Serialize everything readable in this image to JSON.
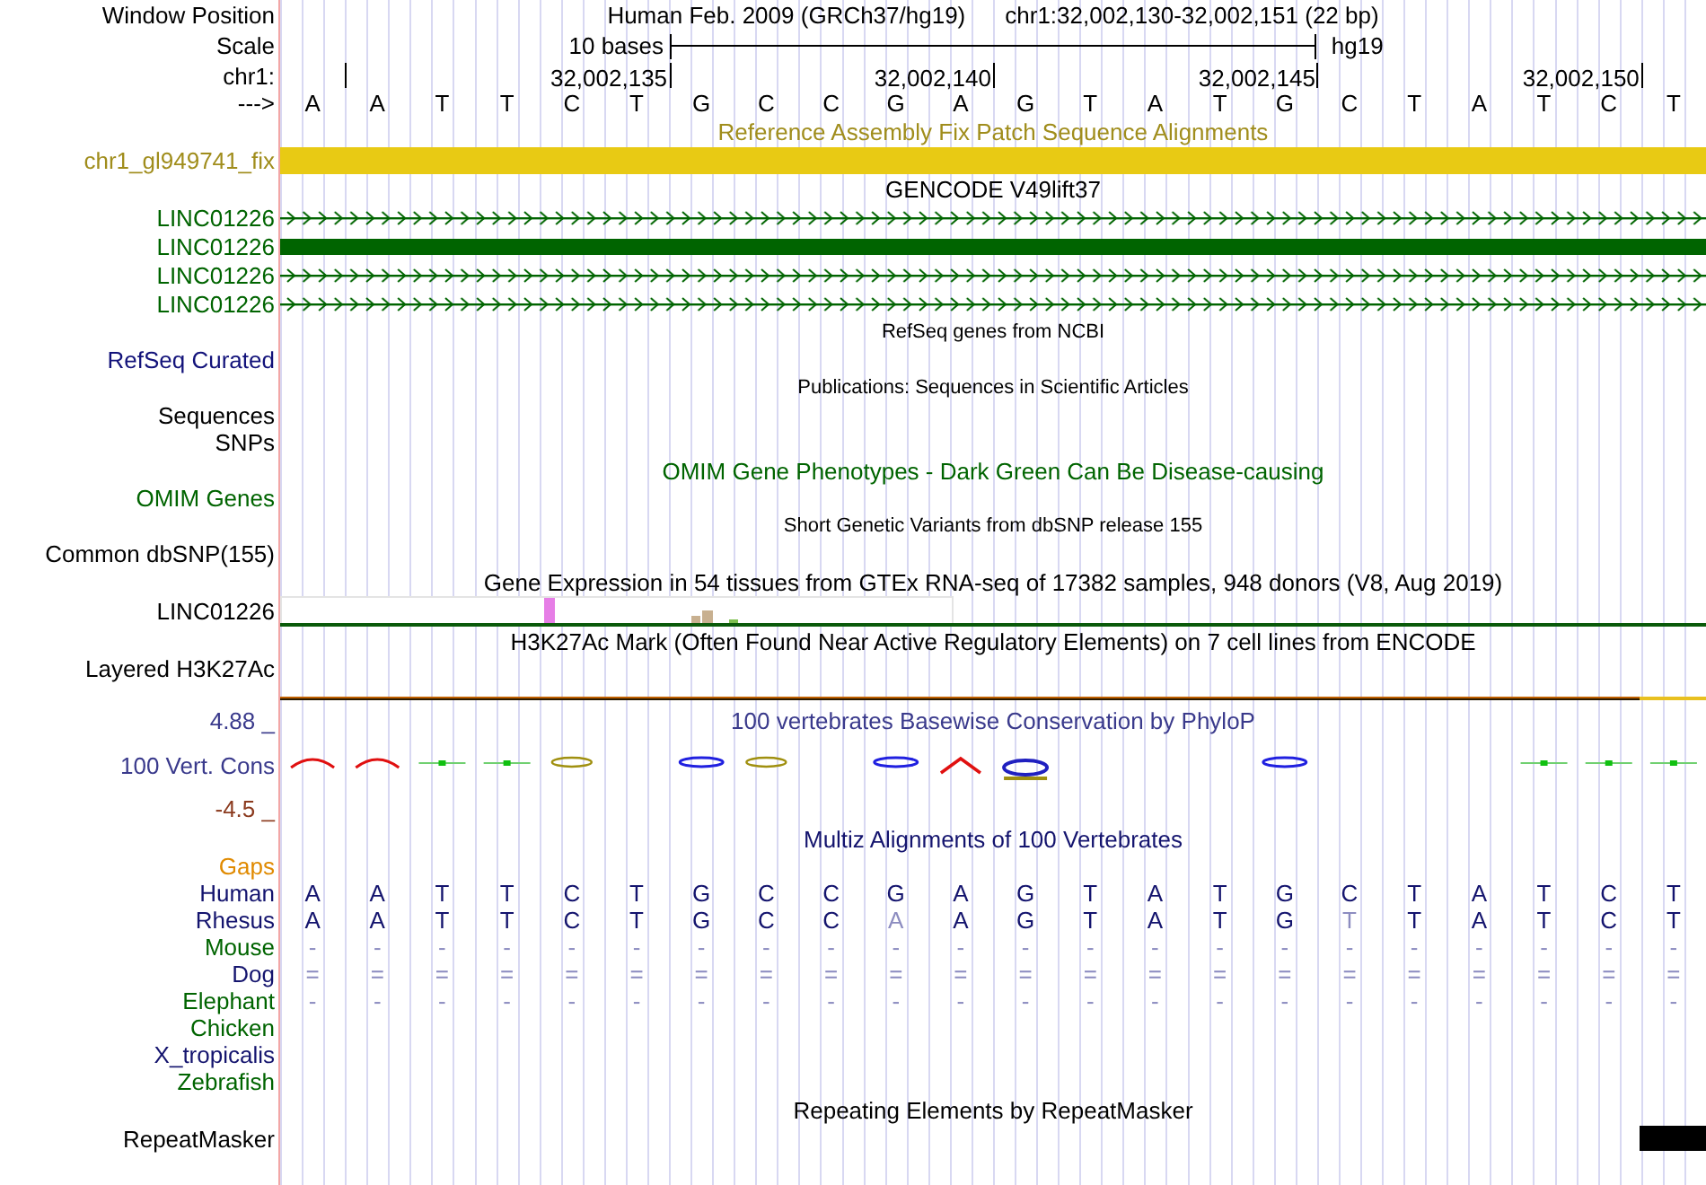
{
  "rows": [
    {
      "kind": "position",
      "label": "Window Position",
      "color": "#000000",
      "assembly": "Human Feb. 2009 (GRCh37/hg19)",
      "range": "chr1:32,002,130-32,002,151 (22 bp)"
    },
    {
      "kind": "scale",
      "label": "Scale",
      "color": "#000000",
      "span": "10 bases",
      "tag": "hg19"
    },
    {
      "kind": "ruler",
      "label": "chr1:",
      "color": "#000000",
      "ticks": [
        "32,002,135",
        "32,002,140",
        "32,002,145",
        "32,002,150"
      ]
    },
    {
      "kind": "sequence",
      "label": "--->",
      "color": "#000000",
      "bases": [
        "A",
        "A",
        "T",
        "T",
        "C",
        "T",
        "G",
        "C",
        "C",
        "G",
        "A",
        "G",
        "T",
        "A",
        "T",
        "G",
        "C",
        "T",
        "A",
        "T",
        "C",
        "T"
      ]
    },
    {
      "kind": "title",
      "text": "Reference Assembly Fix Patch Sequence Alignments",
      "color": "#a08d1c"
    },
    {
      "kind": "fix_bar",
      "label": "chr1_gl949741_fix",
      "color": "#a08d1c"
    },
    {
      "kind": "title",
      "text": "GENCODE V49lift37",
      "color": "#000000"
    },
    {
      "kind": "gene",
      "label": "LINC01226",
      "color": "#006400",
      "solid": false
    },
    {
      "kind": "gene",
      "label": "LINC01226",
      "color": "#006400",
      "solid": true
    },
    {
      "kind": "gene",
      "label": "LINC01226",
      "color": "#006400",
      "solid": false
    },
    {
      "kind": "gene",
      "label": "LINC01226",
      "color": "#006400",
      "solid": false
    },
    {
      "kind": "note",
      "text": "RefSeq genes from NCBI"
    },
    {
      "kind": "label",
      "label": "RefSeq Curated",
      "color": "#12127a"
    },
    {
      "kind": "note",
      "text": "Publications: Sequences in Scientific Articles"
    },
    {
      "kind": "label",
      "label": "Sequences",
      "color": "#000000"
    },
    {
      "kind": "label",
      "label": "SNPs",
      "color": "#000000"
    },
    {
      "kind": "title",
      "text": "OMIM Gene Phenotypes - Dark Green Can Be Disease-causing",
      "color": "#006400"
    },
    {
      "kind": "label",
      "label": "OMIM Genes",
      "color": "#006400"
    },
    {
      "kind": "note",
      "text": "Short Genetic Variants from dbSNP release 155"
    },
    {
      "kind": "label",
      "label": "Common dbSNP(155)",
      "color": "#000000"
    },
    {
      "kind": "title",
      "text": "Gene Expression in 54 tissues from GTEx RNA-seq of 17382 samples, 948 donors (V8, Aug 2019)",
      "color": "#000000"
    },
    {
      "kind": "gtex",
      "label": "LINC01226",
      "color": "#000000"
    },
    {
      "kind": "title",
      "text": "H3K27Ac Mark (Often Found Near Active Regulatory Elements) on 7 cell lines from ENCODE",
      "color": "#000000"
    },
    {
      "kind": "label",
      "label": "Layered H3K27Ac",
      "color": "#000000"
    },
    {
      "kind": "signal"
    },
    {
      "kind": "wiggle",
      "title": "100 vertebrates Basewise Conservation by PhyloP",
      "color": "#3a3a8c",
      "labels": [
        {
          "text": "4.88 _",
          "color": "#3a3a8c"
        },
        {
          "text": "100 Vert. Cons",
          "color": "#3a3a8c"
        },
        {
          "text": "-4.5 _",
          "color": "#8b3a1e"
        }
      ]
    },
    {
      "kind": "title",
      "text": "Multiz Alignments of 100 Vertebrates",
      "color": "#14146e"
    },
    {
      "kind": "label",
      "label": "Gaps",
      "color": "#e08a00"
    },
    {
      "kind": "align",
      "label": "Human",
      "color": "#14146e",
      "cells": [
        {
          "text": "A",
          "faded": false
        },
        {
          "text": "A",
          "faded": false
        },
        {
          "text": "T",
          "faded": false
        },
        {
          "text": "T",
          "faded": false
        },
        {
          "text": "C",
          "faded": false
        },
        {
          "text": "T",
          "faded": false
        },
        {
          "text": "G",
          "faded": false
        },
        {
          "text": "C",
          "faded": false
        },
        {
          "text": "C",
          "faded": false
        },
        {
          "text": "G",
          "faded": false
        },
        {
          "text": "A",
          "faded": false
        },
        {
          "text": "G",
          "faded": false
        },
        {
          "text": "T",
          "faded": false
        },
        {
          "text": "A",
          "faded": false
        },
        {
          "text": "T",
          "faded": false
        },
        {
          "text": "G",
          "faded": false
        },
        {
          "text": "C",
          "faded": false
        },
        {
          "text": "T",
          "faded": false
        },
        {
          "text": "A",
          "faded": false
        },
        {
          "text": "T",
          "faded": false
        },
        {
          "text": "C",
          "faded": false
        },
        {
          "text": "T",
          "faded": false
        }
      ]
    },
    {
      "kind": "align",
      "label": "Rhesus",
      "color": "#14146e",
      "cells": [
        {
          "text": "A",
          "faded": false
        },
        {
          "text": "A",
          "faded": false
        },
        {
          "text": "T",
          "faded": false
        },
        {
          "text": "T",
          "faded": false
        },
        {
          "text": "C",
          "faded": false
        },
        {
          "text": "T",
          "faded": false
        },
        {
          "text": "G",
          "faded": false
        },
        {
          "text": "C",
          "faded": false
        },
        {
          "text": "C",
          "faded": false
        },
        {
          "text": "A",
          "faded": true
        },
        {
          "text": "A",
          "faded": false
        },
        {
          "text": "G",
          "faded": false
        },
        {
          "text": "T",
          "faded": false
        },
        {
          "text": "A",
          "faded": false
        },
        {
          "text": "T",
          "faded": false
        },
        {
          "text": "G",
          "faded": false
        },
        {
          "text": "T",
          "faded": true
        },
        {
          "text": "T",
          "faded": false
        },
        {
          "text": "A",
          "faded": false
        },
        {
          "text": "T",
          "faded": false
        },
        {
          "text": "C",
          "faded": false
        },
        {
          "text": "T",
          "faded": false
        }
      ]
    },
    {
      "kind": "align",
      "label": "Mouse",
      "color": "#006400",
      "cells": [
        {
          "text": "-",
          "faded": true
        },
        {
          "text": "-",
          "faded": true
        },
        {
          "text": "-",
          "faded": true
        },
        {
          "text": "-",
          "faded": true
        },
        {
          "text": "-",
          "faded": true
        },
        {
          "text": "-",
          "faded": true
        },
        {
          "text": "-",
          "faded": true
        },
        {
          "text": "-",
          "faded": true
        },
        {
          "text": "-",
          "faded": true
        },
        {
          "text": "-",
          "faded": true
        },
        {
          "text": "-",
          "faded": true
        },
        {
          "text": "-",
          "faded": true
        },
        {
          "text": "-",
          "faded": true
        },
        {
          "text": "-",
          "faded": true
        },
        {
          "text": "-",
          "faded": true
        },
        {
          "text": "-",
          "faded": true
        },
        {
          "text": "-",
          "faded": true
        },
        {
          "text": "-",
          "faded": true
        },
        {
          "text": "-",
          "faded": true
        },
        {
          "text": "-",
          "faded": true
        },
        {
          "text": "-",
          "faded": true
        },
        {
          "text": "-",
          "faded": true
        }
      ]
    },
    {
      "kind": "align",
      "label": "Dog",
      "color": "#14146e",
      "cells": [
        {
          "text": "=",
          "faded": true
        },
        {
          "text": "=",
          "faded": true
        },
        {
          "text": "=",
          "faded": true
        },
        {
          "text": "=",
          "faded": true
        },
        {
          "text": "=",
          "faded": true
        },
        {
          "text": "=",
          "faded": true
        },
        {
          "text": "=",
          "faded": true
        },
        {
          "text": "=",
          "faded": true
        },
        {
          "text": "=",
          "faded": true
        },
        {
          "text": "=",
          "faded": true
        },
        {
          "text": "=",
          "faded": true
        },
        {
          "text": "=",
          "faded": true
        },
        {
          "text": "=",
          "faded": true
        },
        {
          "text": "=",
          "faded": true
        },
        {
          "text": "=",
          "faded": true
        },
        {
          "text": "=",
          "faded": true
        },
        {
          "text": "=",
          "faded": true
        },
        {
          "text": "=",
          "faded": true
        },
        {
          "text": "=",
          "faded": true
        },
        {
          "text": "=",
          "faded": true
        },
        {
          "text": "=",
          "faded": true
        },
        {
          "text": "=",
          "faded": true
        }
      ]
    },
    {
      "kind": "align",
      "label": "Elephant",
      "color": "#006400",
      "cells": [
        {
          "text": "-",
          "faded": true
        },
        {
          "text": "-",
          "faded": true
        },
        {
          "text": "-",
          "faded": true
        },
        {
          "text": "-",
          "faded": true
        },
        {
          "text": "-",
          "faded": true
        },
        {
          "text": "-",
          "faded": true
        },
        {
          "text": "-",
          "faded": true
        },
        {
          "text": "-",
          "faded": true
        },
        {
          "text": "-",
          "faded": true
        },
        {
          "text": "-",
          "faded": true
        },
        {
          "text": "-",
          "faded": true
        },
        {
          "text": "-",
          "faded": true
        },
        {
          "text": "-",
          "faded": true
        },
        {
          "text": "-",
          "faded": true
        },
        {
          "text": "-",
          "faded": true
        },
        {
          "text": "-",
          "faded": true
        },
        {
          "text": "-",
          "faded": true
        },
        {
          "text": "-",
          "faded": true
        },
        {
          "text": "-",
          "faded": true
        },
        {
          "text": "-",
          "faded": true
        },
        {
          "text": "-",
          "faded": true
        },
        {
          "text": "-",
          "faded": true
        }
      ]
    },
    {
      "kind": "label",
      "label": "Chicken",
      "color": "#006400"
    },
    {
      "kind": "label",
      "label": "X_tropicalis",
      "color": "#14146e"
    },
    {
      "kind": "label",
      "label": "Zebrafish",
      "color": "#006400"
    },
    {
      "kind": "title",
      "text": "Repeating Elements by RepeatMasker",
      "color": "#000000"
    },
    {
      "kind": "repeat",
      "label": "RepeatMasker",
      "color": "#000000"
    }
  ]
}
